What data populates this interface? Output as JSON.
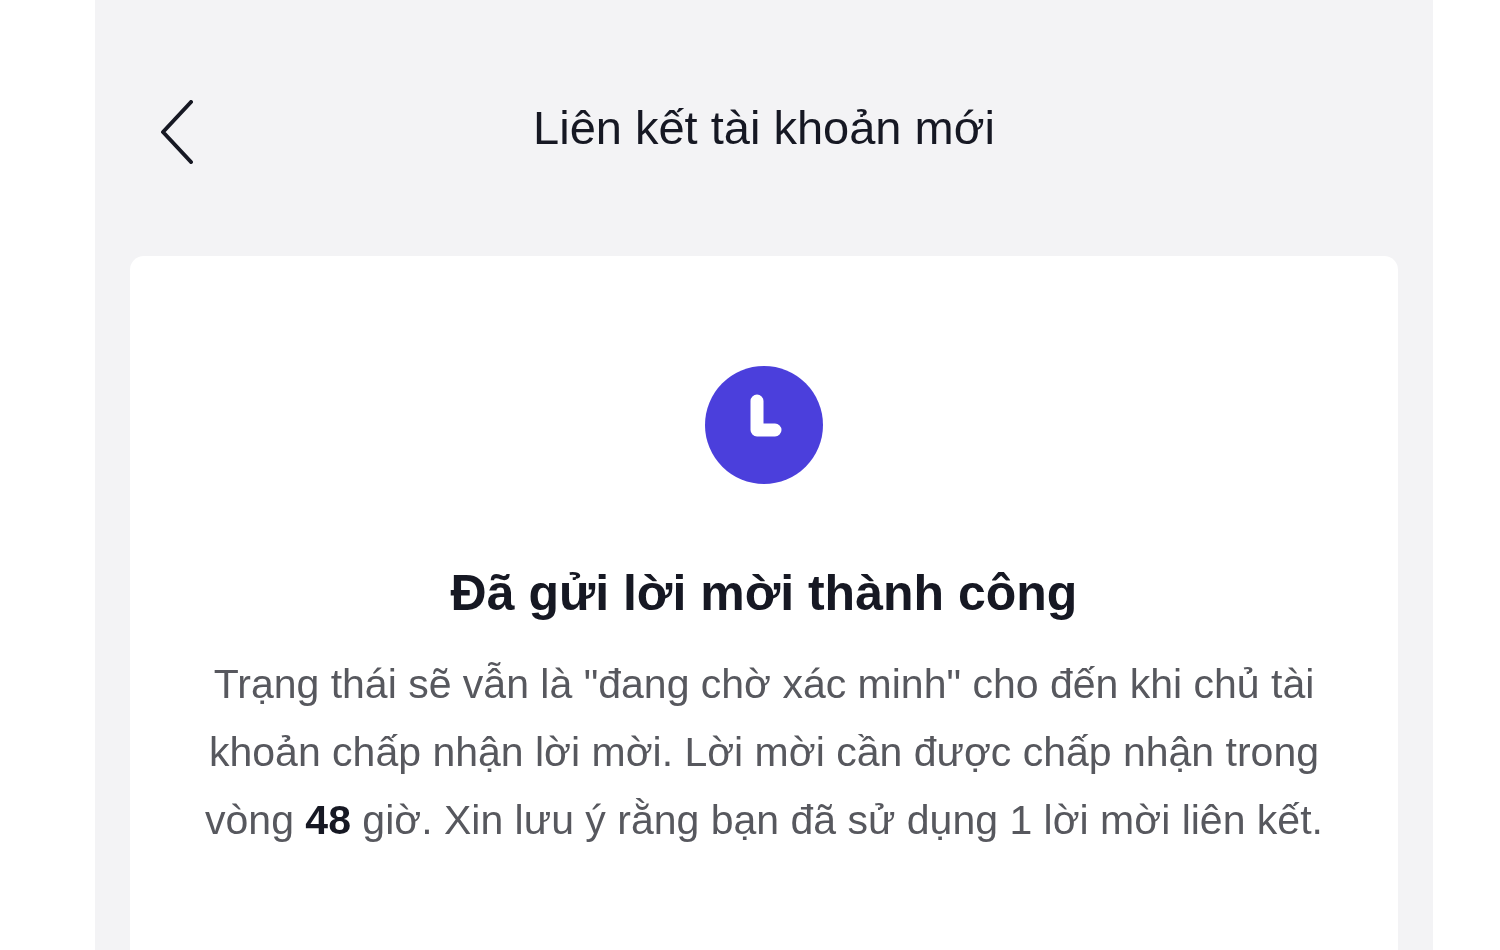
{
  "header": {
    "title": "Liên kết tài khoản mới"
  },
  "card": {
    "title": "Đã gửi lời mời thành công",
    "message": "Trạng thái sẽ vẫn là \"đang chờ xác minh\" cho đến khi chủ tài khoản chấp nhận lời mời. Lời mời cần được chấp nhận trong vòng **48** giờ. Xin lưu ý rằng bạn đã sử dụng 1 lời mời liên kết."
  }
}
